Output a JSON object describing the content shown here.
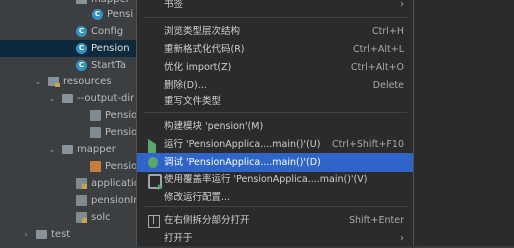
{
  "tree": {
    "rows": [
      {
        "label": "mapper",
        "kind": "folder",
        "arrow": ""
      },
      {
        "label": "Pensi",
        "kind": "class"
      },
      {
        "label": "Config",
        "kind": "class"
      },
      {
        "label": "Pension",
        "kind": "class",
        "selected": true
      },
      {
        "label": "StartTa",
        "kind": "class"
      },
      {
        "label": "resources",
        "kind": "res-folder",
        "arrow": "⌄"
      },
      {
        "label": "--output-dir",
        "kind": "folder",
        "arrow": "⌄"
      },
      {
        "label": "Pension",
        "kind": "file"
      },
      {
        "label": "Pension",
        "kind": "file"
      },
      {
        "label": "mapper",
        "kind": "folder",
        "arrow": "⌄"
      },
      {
        "label": "Pension",
        "kind": "xml"
      },
      {
        "label": "application",
        "kind": "res-file"
      },
      {
        "label": "pensionIns",
        "kind": "file"
      },
      {
        "label": "solc",
        "kind": "res-file"
      },
      {
        "label": "test",
        "kind": "folder",
        "arrow": "›"
      }
    ]
  },
  "menu": {
    "items": [
      {
        "label": "书签",
        "submenu": "›"
      },
      {
        "sep": true
      },
      {
        "label": "浏览类型层次结构",
        "shortcut": "Ctrl+H"
      },
      {
        "label": "重新格式化代码(R)",
        "shortcut": "Ctrl+Alt+L"
      },
      {
        "label": "优化 import(Z)",
        "shortcut": "Ctrl+Alt+O"
      },
      {
        "label": "删除(D)...",
        "shortcut": "Delete"
      },
      {
        "label": "重写文件类型"
      },
      {
        "sep": true
      },
      {
        "label": "构建模块 'pension'(M)"
      },
      {
        "label": "运行 'PensionApplica....main()'(U)",
        "shortcut": "Ctrl+Shift+F10",
        "icon": "run"
      },
      {
        "label": "调试 'PensionApplica....main()'(D)",
        "icon": "debug",
        "highlighted": true
      },
      {
        "label": "使用覆盖率运行 'PensionApplica....main()'(V)",
        "icon": "coverage"
      },
      {
        "label": "修改运行配置..."
      },
      {
        "sep": true
      },
      {
        "label": "在右侧拆分部分打开",
        "shortcut": "Shift+Enter",
        "icon": "split"
      },
      {
        "label": "打开于",
        "submenu": "›"
      }
    ]
  }
}
